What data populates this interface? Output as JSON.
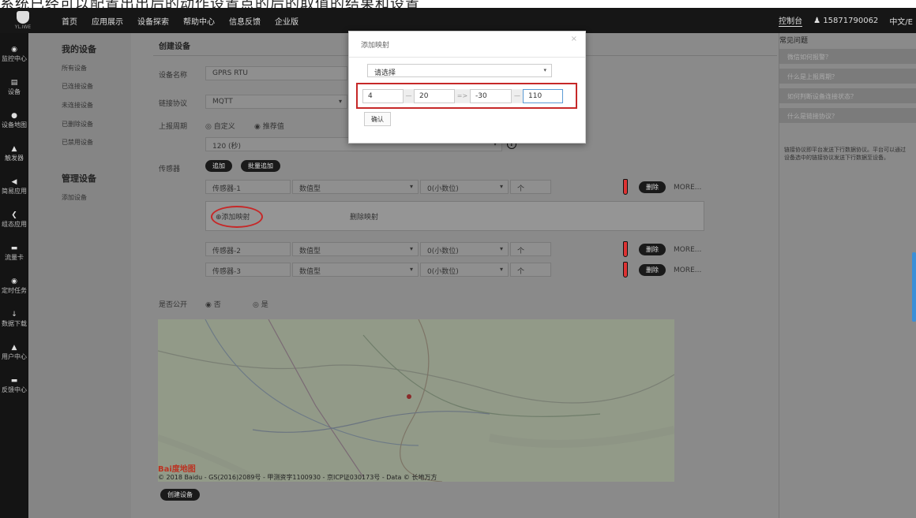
{
  "caption": "系统已经可以配置出出后的动作设置点的后的取值的结果和设置",
  "logo": {
    "text": "YL.IWE"
  },
  "nav": [
    "首页",
    "应用展示",
    "设备探索",
    "帮助中心",
    "信息反馈",
    "企业版"
  ],
  "top_right": {
    "console": "控制台",
    "user": "15871790062",
    "lang": "中文/E"
  },
  "sidenav": [
    {
      "icon": "◉",
      "label": "监控中心"
    },
    {
      "icon": "▤",
      "label": "设备"
    },
    {
      "icon": "●",
      "label": "设备地图"
    },
    {
      "icon": "▲",
      "label": "触发器"
    },
    {
      "icon": "◀",
      "label": "简易应用"
    },
    {
      "icon": "❮",
      "label": "组态应用"
    },
    {
      "icon": "▬",
      "label": "流量卡"
    },
    {
      "icon": "◉",
      "label": "定时任务"
    },
    {
      "icon": "↓",
      "label": "数据下载"
    },
    {
      "icon": "▲",
      "label": "用户中心"
    },
    {
      "icon": "▬",
      "label": "反馈中心"
    }
  ],
  "submenu": {
    "group1": "我的设备",
    "items1": [
      "所有设备",
      "已连接设备",
      "未连接设备",
      "已删除设备",
      "已禁用设备"
    ],
    "group2": "管理设备",
    "items2": [
      "添加设备"
    ]
  },
  "form": {
    "header": "创建设备",
    "name_label": "设备名称",
    "name_value": "GPRS RTU",
    "protocol_label": "链接协议",
    "protocol_value": "MQTT",
    "period_label": "上报周期",
    "period_custom": "◎ 自定义",
    "period_recommended": "◉ 推荐值",
    "period_value": "120 (秒)",
    "sensor_label": "传感器",
    "add_button": "追加",
    "batch_add_button": "批量追加",
    "sensors": [
      {
        "name": "传感器-1",
        "type": "数值型",
        "decimals": "0(小数位)",
        "unit": "个",
        "delete": "删除",
        "more": "MORE..."
      },
      {
        "name": "传感器-2",
        "type": "数值型",
        "decimals": "0(小数位)",
        "unit": "个",
        "delete": "删除",
        "more": "MORE..."
      },
      {
        "name": "传感器-3",
        "type": "数值型",
        "decimals": "0(小数位)",
        "unit": "个",
        "delete": "删除",
        "more": "MORE..."
      }
    ],
    "add_mapping": "添加映射",
    "delete_mapping": "删除映射",
    "public_label": "是否公开",
    "public_no": "◉ 否",
    "public_yes": "◎ 是",
    "create_button": "创建设备"
  },
  "map": {
    "baidu": "Bai度地图",
    "copyright": "© 2018 Baidu - GS(2016)2089号 - 甲测资字1100930 - 京ICP证030173号 - Data © 长地万方"
  },
  "faq": {
    "title": "常见问题",
    "questions": [
      "微信如何报警？",
      "什么是上报周期？",
      "如何判断设备连接状态？",
      "什么是链接协议？"
    ],
    "answer": "链接协议即平台发送下行数据协议。平台可以通过设备选中的链接协议发送下行数据至设备。"
  },
  "modal": {
    "title": "添加映射",
    "close": "×",
    "select_placeholder": "请选择",
    "from_min": "4",
    "from_max": "20",
    "to_min": "-30",
    "to_max": "110",
    "dash": "—",
    "arrow": "=>",
    "confirm": "确认"
  }
}
